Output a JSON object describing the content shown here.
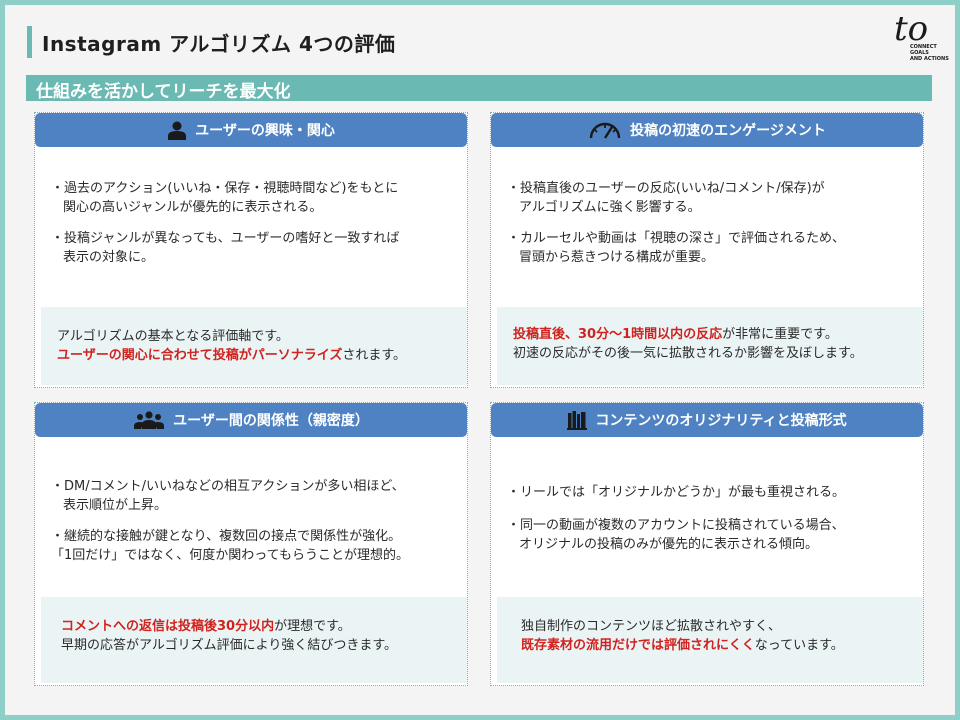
{
  "title": "Instagram アルゴリズム 4つの評価",
  "subtitle": "仕組みを活かしてリーチを最大化",
  "logo": {
    "mark": "to",
    "tagline": [
      "CONNECT",
      "GOALS",
      "AND ACTIONS"
    ]
  },
  "cards": [
    {
      "icon": "person-icon",
      "heading": "ユーザーの興味・関心",
      "bullets": [
        [
          "・過去のアクション(いいね・保存・視聴時間など)をもとに",
          "関心の高いジャンルが優先的に表示される。"
        ],
        [
          "・投稿ジャンルが異なっても、ユーザーの嗜好と一致すれば",
          "表示の対象に。"
        ]
      ],
      "summary": [
        {
          "text": "アルゴリズムの基本となる評価軸です。"
        },
        {
          "red": "ユーザーの関心に合わせて投稿がパーソナライズ",
          "text": "されます。"
        }
      ]
    },
    {
      "icon": "speedometer-icon",
      "heading": "投稿の初速のエンゲージメント",
      "bullets": [
        [
          "・投稿直後のユーザーの反応(いいね/コメント/保存)が",
          "アルゴリズムに強く影響する。"
        ],
        [
          "・カルーセルや動画は「視聴の深さ」で評価されるため、",
          "冒頭から惹きつける構成が重要。"
        ]
      ],
      "summary": [
        {
          "red": "投稿直後、30分～1時間以内の反応",
          "text": "が非常に重要です。"
        },
        {
          "text": "初速の反応がその後一気に拡散されるか影響を及ぼします。"
        }
      ]
    },
    {
      "icon": "group-icon",
      "heading": "ユーザー間の関係性（親密度）",
      "bullets": [
        [
          "・DM/コメント/いいねなどの相互アクションが多い相ほど、",
          "表示順位が上昇。"
        ],
        [
          "・継続的な接触が鍵となり、複数回の接点で関係性が強化。",
          "「1回だけ」ではなく、何度か関わってもらうことが理想的。"
        ]
      ],
      "summary": [
        {
          "red": "コメントへの返信は投稿後30分以内",
          "text": "が理想です。"
        },
        {
          "text": "早期の応答がアルゴリズム評価により強く結びつきます。"
        }
      ]
    },
    {
      "icon": "bookshelf-icon",
      "heading": "コンテンツのオリジナリティと投稿形式",
      "bullets": [
        [
          "・リールでは「オリジナルかどうか」が最も重視される。"
        ],
        [
          "・同一の動画が複数のアカウントに投稿されている場合、",
          "オリジナルの投稿のみが優先的に表示される傾向。"
        ]
      ],
      "summary": [
        {
          "text": "独自制作のコンテンツほど拡散されやすく、"
        },
        {
          "red": "既存素材の流用だけでは評価されにくく",
          "text": "なっています。"
        }
      ]
    }
  ]
}
